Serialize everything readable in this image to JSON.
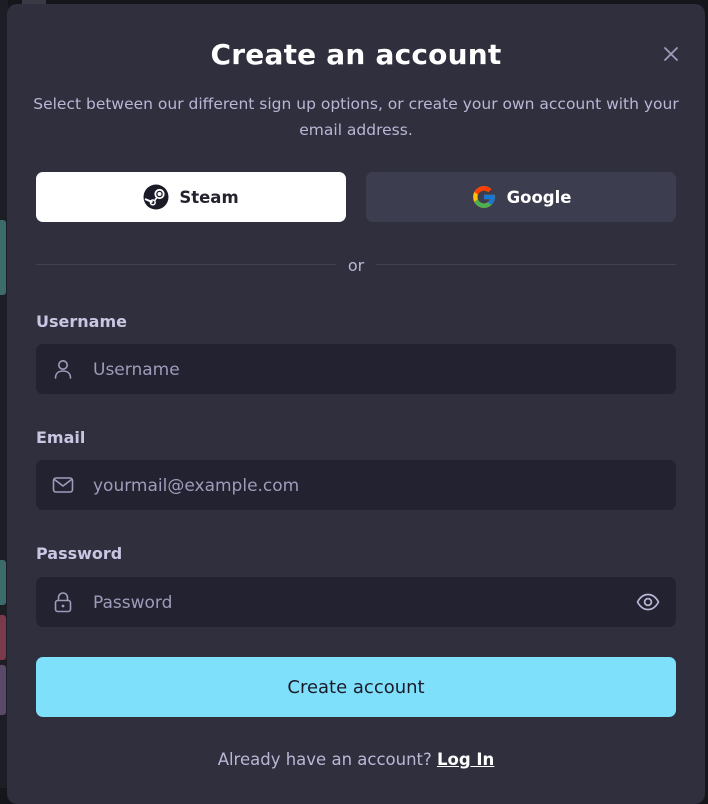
{
  "modal": {
    "title": "Create an account",
    "subtitle": "Select between our different sign up options, or create your own account with your email address.",
    "close_icon": "close-icon"
  },
  "oauth": {
    "steam_label": "Steam",
    "google_label": "Google"
  },
  "divider_text": "or",
  "form": {
    "username": {
      "label": "Username",
      "placeholder": "Username",
      "value": ""
    },
    "email": {
      "label": "Email",
      "placeholder": "yourmail@example.com",
      "value": ""
    },
    "password": {
      "label": "Password",
      "placeholder": "Password",
      "value": ""
    }
  },
  "submit_label": "Create account",
  "footer": {
    "prompt": "Already have an account? ",
    "login_link": "Log In"
  },
  "colors": {
    "modal_bg": "#2f2f3d",
    "input_bg": "#222230",
    "accent": "#7fe0fc",
    "steam_bg": "#ffffff",
    "google_bg": "#3d3d50"
  }
}
